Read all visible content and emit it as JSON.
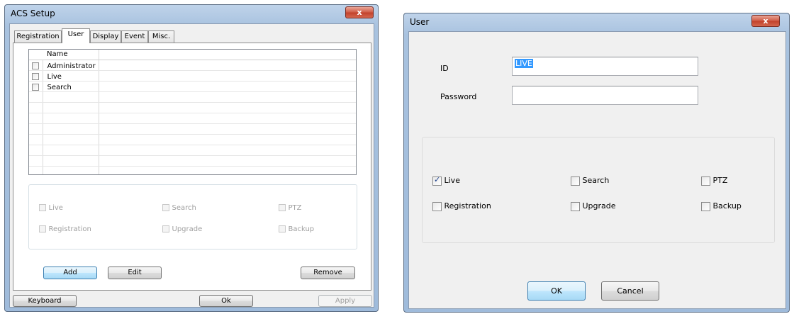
{
  "acs_setup": {
    "title": "ACS Setup",
    "close_label": "x",
    "tabs": [
      {
        "label": "Registration",
        "active": false
      },
      {
        "label": "User",
        "active": true
      },
      {
        "label": "Display",
        "active": false
      },
      {
        "label": "Event",
        "active": false
      },
      {
        "label": "Misc.",
        "active": false
      }
    ],
    "user_list": {
      "column_header": "Name",
      "users": [
        {
          "name": "Administrator",
          "checked": false
        },
        {
          "name": "Live",
          "checked": false
        },
        {
          "name": "Search",
          "checked": false
        }
      ]
    },
    "permissions": [
      {
        "label": "Live",
        "checked": false,
        "enabled": false
      },
      {
        "label": "Search",
        "checked": false,
        "enabled": false
      },
      {
        "label": "PTZ",
        "checked": false,
        "enabled": false
      },
      {
        "label": "Registration",
        "checked": false,
        "enabled": false
      },
      {
        "label": "Upgrade",
        "checked": false,
        "enabled": false
      },
      {
        "label": "Backup",
        "checked": false,
        "enabled": false
      }
    ],
    "buttons": {
      "add": "Add",
      "edit": "Edit",
      "remove": "Remove",
      "keyboard": "Keyboard",
      "ok": "Ok",
      "apply": "Apply"
    }
  },
  "user_dialog": {
    "title": "User",
    "close_label": "x",
    "id_label": "ID",
    "id_value": "LIVE",
    "password_label": "Password",
    "password_value": "",
    "permissions": [
      {
        "label": "Live",
        "checked": true
      },
      {
        "label": "Search",
        "checked": false
      },
      {
        "label": "PTZ",
        "checked": false
      },
      {
        "label": "Registration",
        "checked": false
      },
      {
        "label": "Upgrade",
        "checked": false
      },
      {
        "label": "Backup",
        "checked": false
      }
    ],
    "buttons": {
      "ok": "OK",
      "cancel": "Cancel"
    }
  },
  "colors": {
    "frame_blue": "#a8c2df",
    "client_gray": "#f0f0f0",
    "close_red": "#c3432c",
    "selection_blue": "#3399ff"
  }
}
